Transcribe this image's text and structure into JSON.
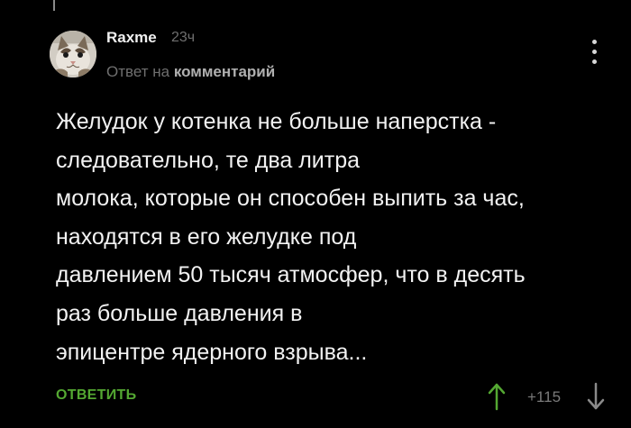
{
  "comment": {
    "username": "Raxme",
    "time": "23ч",
    "reply_prefix": "Ответ на",
    "reply_target": "комментарий",
    "body_lines": [
      "Желудок у котенка не больше наперстка -",
      "следовательно, те два литра",
      "молока, которые он способен выпить за час,",
      "находятся в его желудке под",
      "давлением 50 тысяч атмосфер, что в десять",
      "раз больше давления в",
      "эпицентре ядерного взрыва..."
    ]
  },
  "actions": {
    "reply_label": "ОТВЕТИТЬ",
    "rating": "+115"
  },
  "icons": {
    "avatar": "cat-avatar",
    "more": "more-vertical-icon",
    "vote_up": "arrow-up-icon",
    "vote_down": "arrow-down-icon"
  },
  "colors": {
    "background": "#000000",
    "accent_green": "#54a832",
    "muted_text": "#6f6f6f",
    "body_text": "#f2f2f2"
  }
}
